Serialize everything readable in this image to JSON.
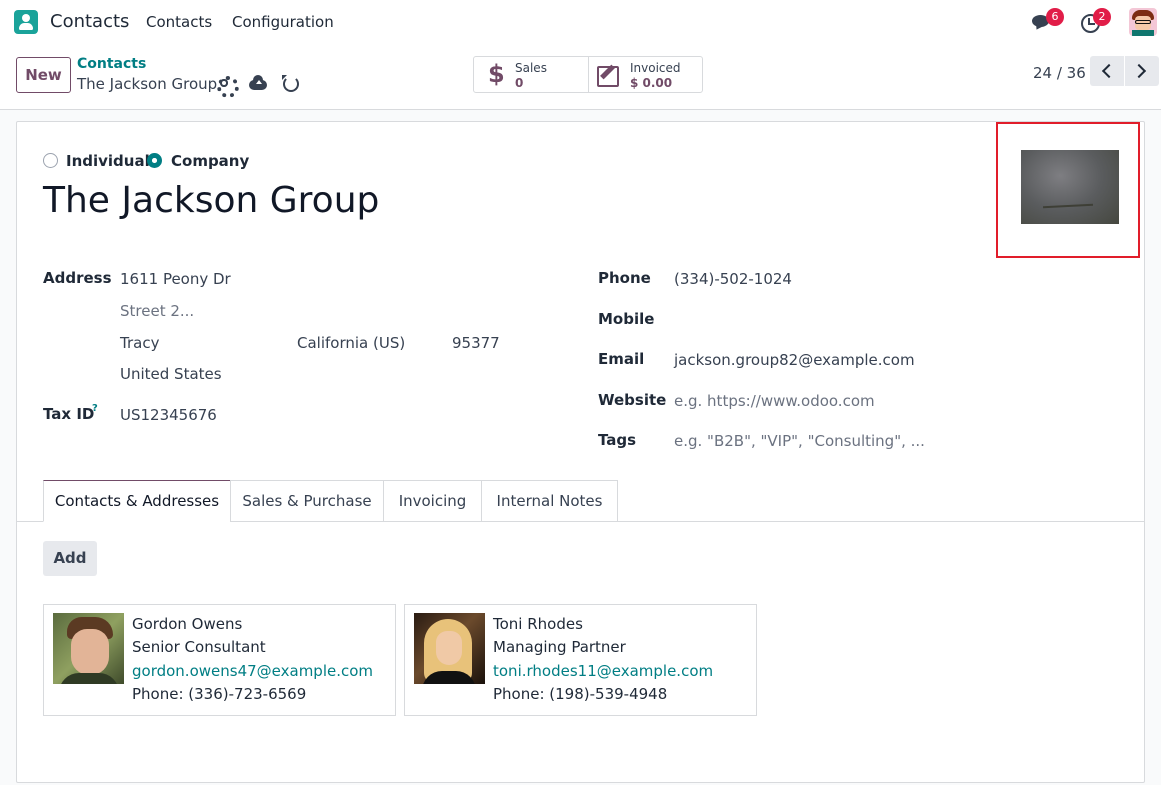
{
  "navbar": {
    "app_name": "Contacts",
    "menu": [
      "Contacts",
      "Configuration"
    ],
    "messages_badge": "6",
    "activities_badge": "2"
  },
  "control_panel": {
    "new_label": "New",
    "breadcrumb_parent": "Contacts",
    "breadcrumb_current": "The Jackson Group",
    "smart_buttons": [
      {
        "label": "Sales",
        "value": "0",
        "icon": "dollar-icon"
      },
      {
        "label": "Invoiced",
        "value": "$ 0.00",
        "icon": "edit-icon"
      }
    ],
    "pager": "24 / 36"
  },
  "form": {
    "type_options": [
      "Individual",
      "Company"
    ],
    "type_selected": "Company",
    "name": "The Jackson Group",
    "address": {
      "label": "Address",
      "street": "1611 Peony Dr",
      "street2_placeholder": "Street 2...",
      "city": "Tracy",
      "state": "California (US)",
      "zip": "95377",
      "country": "United States"
    },
    "tax_id": {
      "label": "Tax ID",
      "help": "?",
      "value": "US12345676"
    },
    "phone": {
      "label": "Phone",
      "value": "(334)-502-1024"
    },
    "mobile": {
      "label": "Mobile",
      "value": ""
    },
    "email": {
      "label": "Email",
      "value": "jackson.group82@example.com"
    },
    "website": {
      "label": "Website",
      "placeholder": "e.g. https://www.odoo.com"
    },
    "tags": {
      "label": "Tags",
      "placeholder": "e.g. \"B2B\", \"VIP\", \"Consulting\", ..."
    }
  },
  "tabs": [
    "Contacts & Addresses",
    "Sales & Purchase",
    "Invoicing",
    "Internal Notes"
  ],
  "active_tab": "Contacts & Addresses",
  "add_label": "Add",
  "contacts": [
    {
      "name": "Gordon Owens",
      "role": "Senior Consultant",
      "email": "gordon.owens47@example.com",
      "phone": "Phone: (336)-723-6569"
    },
    {
      "name": "Toni Rhodes",
      "role": "Managing Partner",
      "email": "toni.rhodes11@example.com",
      "phone": "Phone: (198)-539-4948"
    }
  ],
  "colors": {
    "brand": "#714b67",
    "accent": "#017e84",
    "badge": "#e11d48",
    "highlight": "#e11d2a"
  }
}
